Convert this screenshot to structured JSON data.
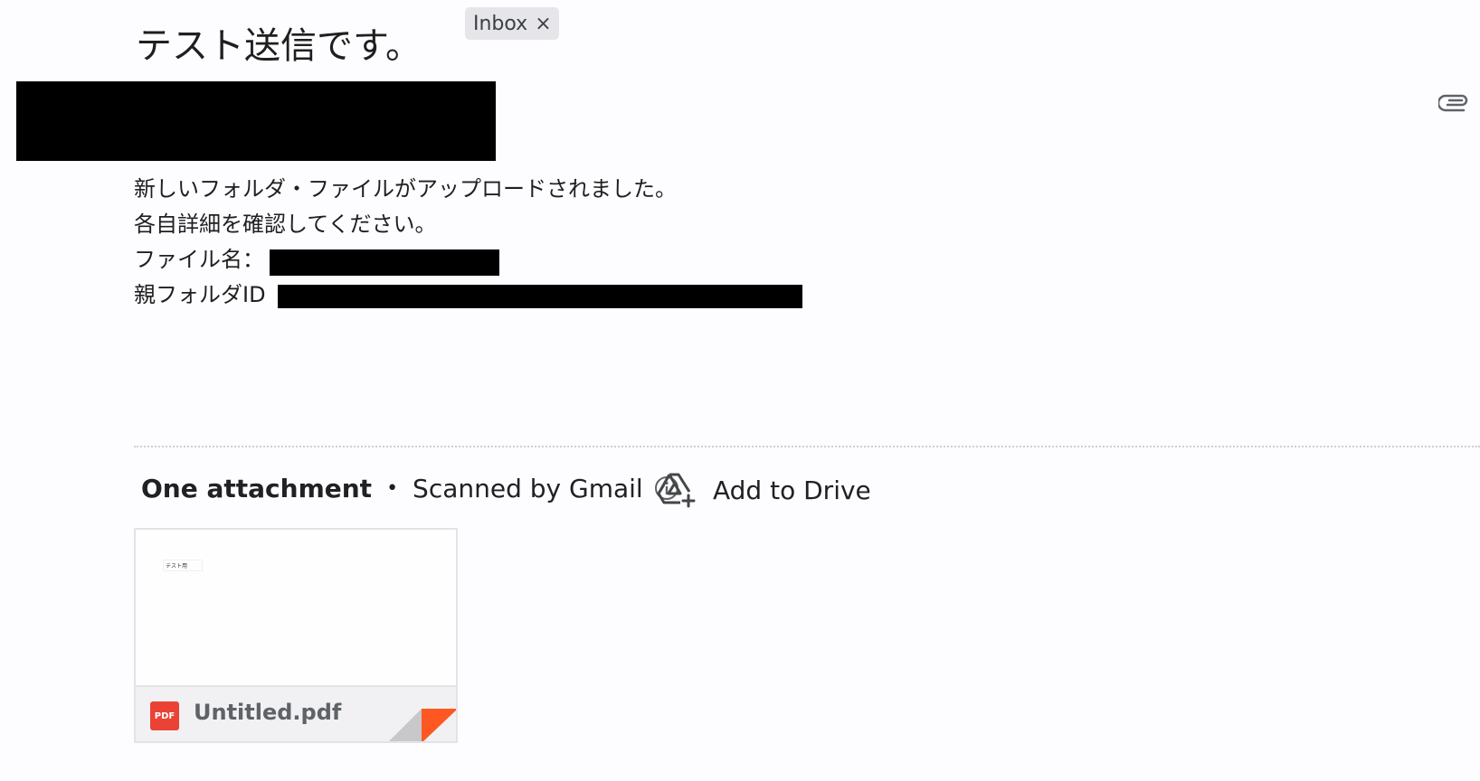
{
  "email": {
    "subject": "テスト送信です。",
    "label": "Inbox",
    "label_remove_glyph": "×",
    "body_lines": [
      "新しいフォルダ・ファイルがアップロードされました。",
      "各自詳細を確認してください。",
      "ファイル名：",
      "親フォルダID"
    ]
  },
  "attachments": {
    "count_label": "One attachment",
    "separator": "•",
    "scanned_label": "Scanned by Gmail",
    "add_to_drive_label": "Add to Drive",
    "items": [
      {
        "name": "Untitled.pdf",
        "type_badge": "PDF",
        "thumb_text": "テスト用"
      }
    ]
  },
  "icons": {
    "clip": "paperclip-icon",
    "info": "info-icon",
    "drive": "add-to-drive-icon",
    "pdf": "pdf-icon"
  },
  "colors": {
    "background": "#fdfcfe",
    "chip_bg": "#e6e5e9",
    "pdf_red": "#ea4335",
    "corner_orange": "#ff5722"
  }
}
